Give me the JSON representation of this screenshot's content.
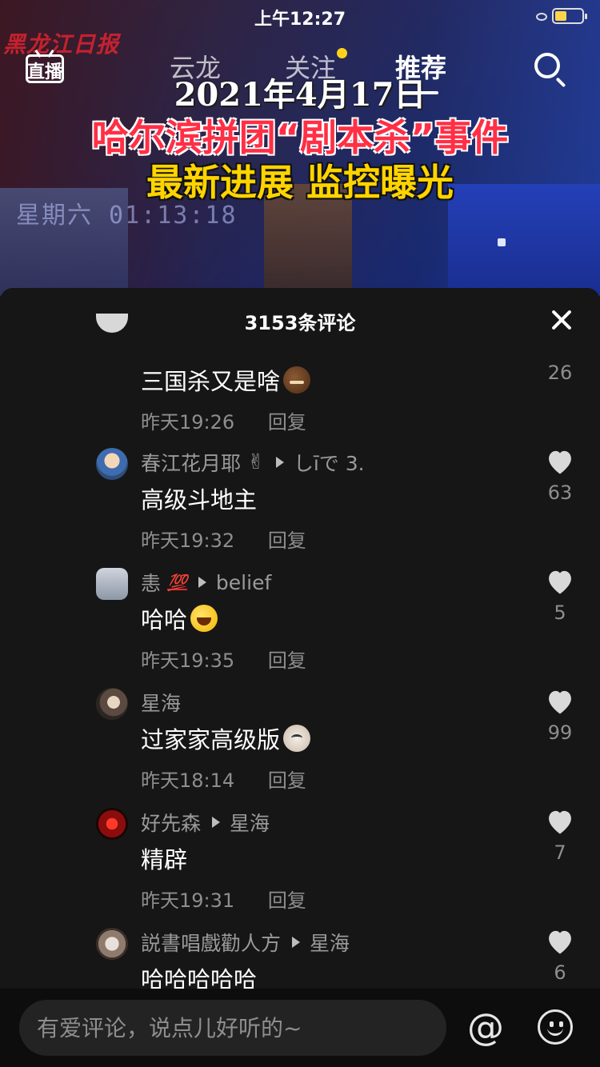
{
  "status": {
    "time": "上午12:27"
  },
  "video": {
    "watermark": "黑龙江日报",
    "date_line": "2021年4月17日",
    "title_red": "哈尔滨拼团“剧本杀”事件",
    "title_yellow": "最新进展 监控曝光",
    "cam_text": "星期六 01:13:18"
  },
  "nav": {
    "live_label": "直播",
    "tabs": [
      {
        "label": "云龙"
      },
      {
        "label": "关注"
      },
      {
        "label": "推荐"
      }
    ],
    "active_tab": "推荐",
    "follow_dot_color": "#ffd31c"
  },
  "comments_panel": {
    "title": "3153条评论",
    "comments": [
      {
        "user": "",
        "reply_to": "",
        "text": "三国杀又是啥",
        "emoji": "mean-face",
        "time": "昨天19:26",
        "reply_label": "回复",
        "likes": "26"
      },
      {
        "user": "春江花月耶",
        "user_emoji": "✌",
        "reply_to": "しīで 3.",
        "text": "高级斗地主",
        "time": "昨天19:32",
        "reply_label": "回复",
        "likes": "63"
      },
      {
        "user": "恚",
        "user_emoji": "💯",
        "reply_to": "belief",
        "text": "哈哈",
        "emoji": "laughing-face",
        "time": "昨天19:35",
        "reply_label": "回复",
        "likes": "5"
      },
      {
        "user": "星海",
        "reply_to": "",
        "text": "过家家高级版",
        "emoji": "cat-face",
        "time": "昨天18:14",
        "reply_label": "回复",
        "likes": "99"
      },
      {
        "user": "好先森",
        "reply_to": "星海",
        "text": "精辟",
        "time": "昨天19:31",
        "reply_label": "回复",
        "likes": "7"
      },
      {
        "user": "説書唱戲勸人方",
        "reply_to": "星海",
        "text": "哈哈哈哈哈",
        "time": "",
        "reply_label": "",
        "likes": "6"
      }
    ]
  },
  "composer": {
    "placeholder": "有爱评论，说点儿好听的~",
    "at_symbol": "@"
  },
  "colors": {
    "panel_bg": "#161616",
    "accent_red": "#ff2f45",
    "accent_yellow": "#ffd400",
    "muted_text": "#8e8e8e",
    "heart": "#d9d9d9"
  }
}
